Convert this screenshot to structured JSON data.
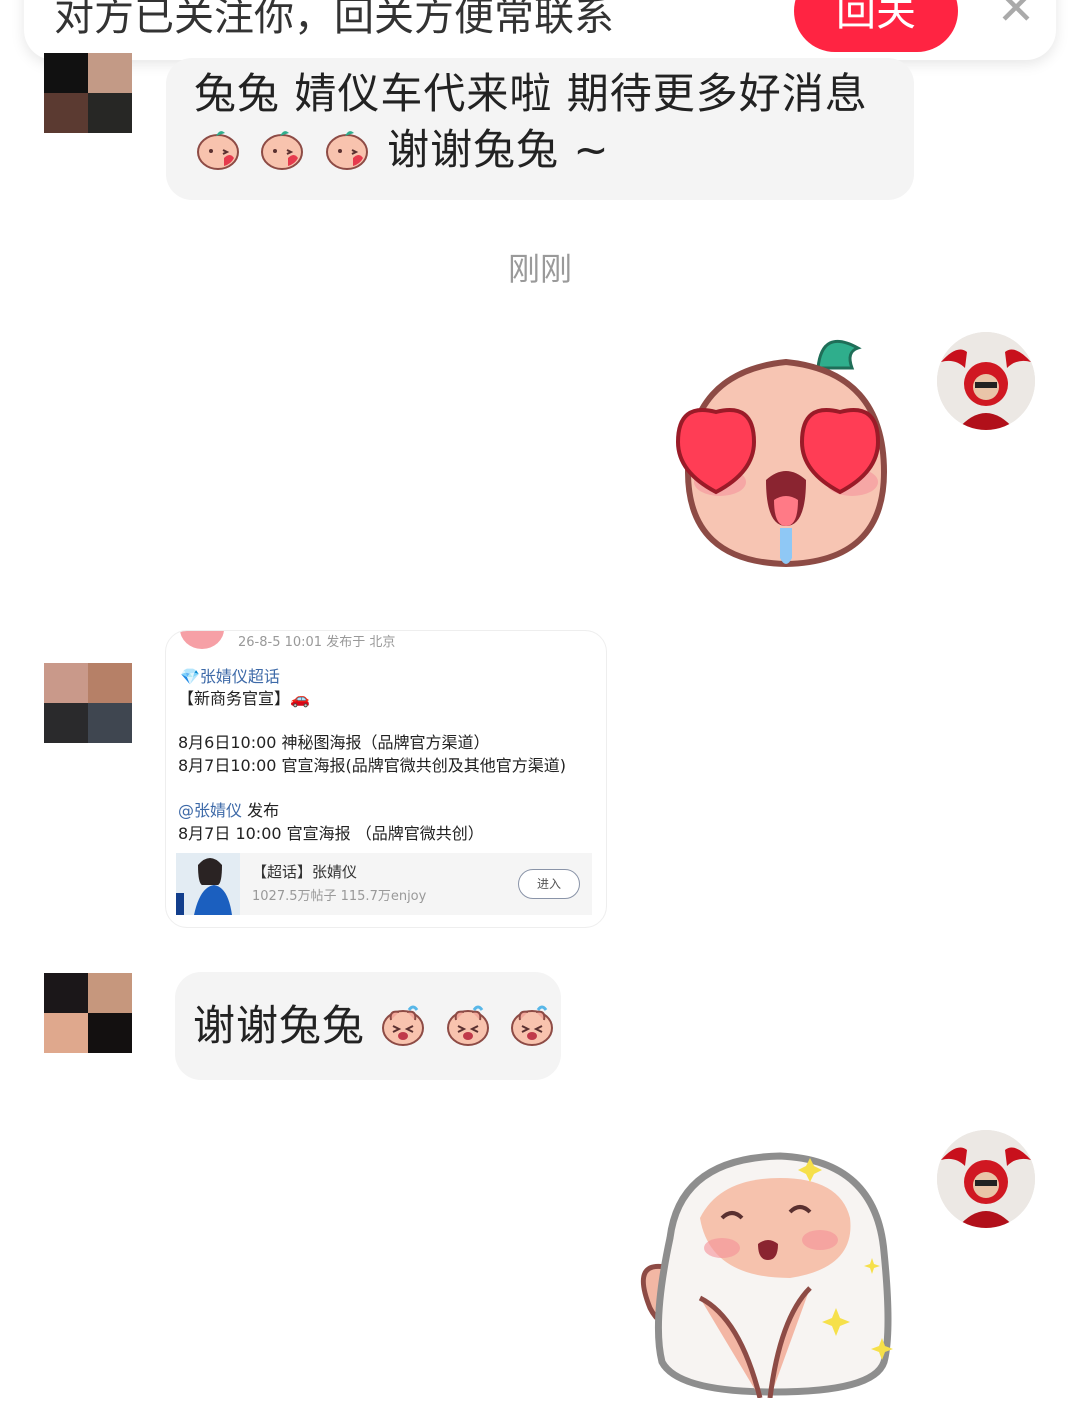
{
  "banner": {
    "text": "对方已关注你，回关方便常联系",
    "follow_label": "回关",
    "close_glyph": "✕"
  },
  "messages": [
    {
      "type": "text",
      "text_line1": "兔兔 婧仪车代来啦 期待更多好消息",
      "text_line2": "谢谢兔兔 ~",
      "emoji": "kiss-emoji"
    },
    {
      "type": "timestamp",
      "text": "刚刚"
    },
    {
      "type": "sticker",
      "name": "heart-eyes-sticker"
    },
    {
      "type": "shared-post",
      "meta": "26-8-5 10:01  发布于 北京",
      "topic": "💎张婧仪超话",
      "headline": "【新商务官宣】🚗",
      "line1": "8月6日10:00 神秘图海报（品牌官方渠道）",
      "line2": "8月7日10:00 官宣海报(品牌官微共创及其他官方渠道)",
      "mention": "@张婧仪",
      "mention_suffix": " 发布",
      "line3": "8月7日 10:00 官宣海报 （品牌官微共创）",
      "sub_title": "【超话】张婧仪",
      "sub_stats": "1027.5万帖子 115.7万enjoy",
      "enter_label": "进入"
    },
    {
      "type": "text",
      "text": "谢谢兔兔",
      "emoji": "crying-emoji"
    },
    {
      "type": "sticker",
      "name": "praying-sticker"
    }
  ],
  "colors": {
    "accent": "#ff2442",
    "bubble": "#f4f4f4",
    "link": "#3e6aa8"
  }
}
